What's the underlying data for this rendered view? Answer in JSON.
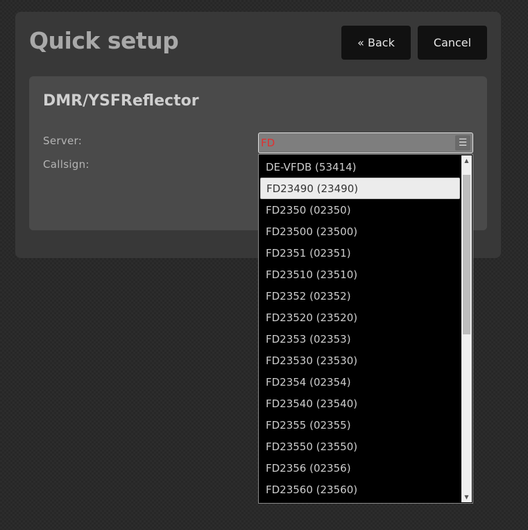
{
  "header": {
    "title": "Quick setup",
    "back_label": "« Back",
    "cancel_label": "Cancel"
  },
  "card": {
    "title": "DMR/YSFReflector",
    "server_label": "Server:",
    "callsign_label": "Callsign:"
  },
  "server": {
    "value": "FD",
    "text_color": "#e03030",
    "icon": "list-icon"
  },
  "dropdown": {
    "selected_index": 1,
    "options": [
      "DE-VFDB (53414)",
      "FD23490 (23490)",
      "FD2350 (02350)",
      "FD23500 (23500)",
      "FD2351 (02351)",
      "FD23510 (23510)",
      "FD2352 (02352)",
      "FD23520 (23520)",
      "FD2353 (02353)",
      "FD23530 (23530)",
      "FD2354 (02354)",
      "FD23540 (23540)",
      "FD2355 (02355)",
      "FD23550 (23550)",
      "FD2356 (02356)",
      "FD23560 (23560)"
    ]
  }
}
